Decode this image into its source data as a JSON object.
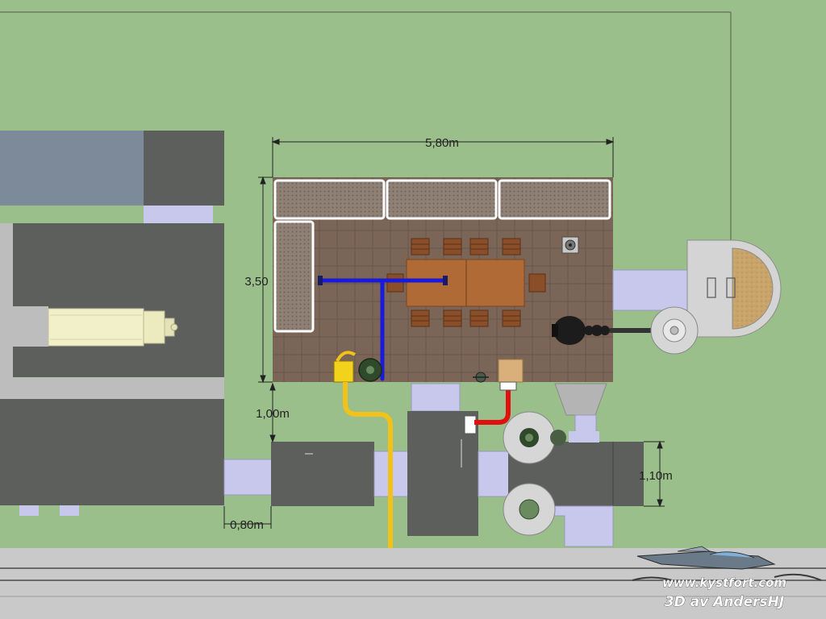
{
  "dimensions": {
    "width_label": "5,80m",
    "height_label": "3,50",
    "gap_label": "1,00m",
    "side_label": "0,80m",
    "right_label": "1,10m"
  },
  "watermark": {
    "line1": "www.kystfort.com",
    "line2": "3D av AndersHJ"
  },
  "colors": {
    "ground": "#9bbf8a",
    "floor": "#7a6557",
    "concrete_dark": "#5c5f5c",
    "duct_lavender": "#c8c8ec",
    "pipe_blue": "#1a1adb",
    "pipe_yellow": "#f2c21a",
    "pipe_red": "#e01010",
    "table_wood": "#b06a35",
    "road": "#c9c9c9"
  }
}
